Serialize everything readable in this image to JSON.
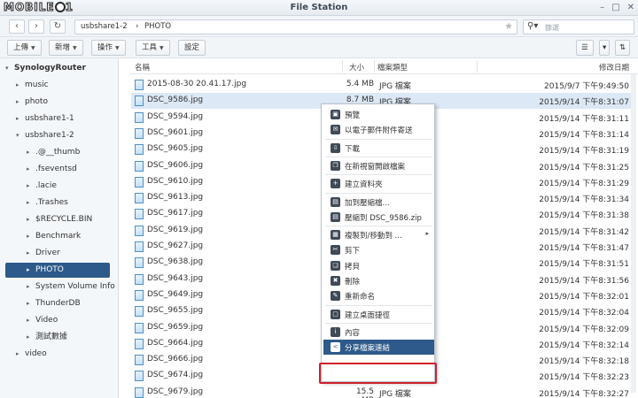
{
  "watermark": "MOBILE01",
  "window": {
    "title": "File Station"
  },
  "nav": {
    "path": [
      "usbshare1-2",
      "PHOTO"
    ],
    "search_placeholder": "篩選"
  },
  "toolbar": {
    "upload": "上傳",
    "create": "新增",
    "action": "操作",
    "tools": "工具",
    "settings": "設定"
  },
  "sidebar": {
    "root": "SynologyRouter",
    "items": [
      {
        "label": "music",
        "level": 1,
        "arrow": "▸"
      },
      {
        "label": "photo",
        "level": 1,
        "arrow": "▸"
      },
      {
        "label": "usbshare1-1",
        "level": 1,
        "arrow": "▸"
      },
      {
        "label": "usbshare1-2",
        "level": 1,
        "arrow": "▾"
      },
      {
        "label": ".@__thumb",
        "level": 2,
        "arrow": "▸"
      },
      {
        "label": ".fseventsd",
        "level": 2,
        "arrow": "▸"
      },
      {
        "label": ".lacie",
        "level": 2,
        "arrow": "▸"
      },
      {
        "label": ".Trashes",
        "level": 2,
        "arrow": "▸"
      },
      {
        "label": "$RECYCLE.BIN",
        "level": 2,
        "arrow": "▸"
      },
      {
        "label": "Benchmark",
        "level": 2,
        "arrow": "▸"
      },
      {
        "label": "Driver",
        "level": 2,
        "arrow": "▸"
      },
      {
        "label": "PHOTO",
        "level": 2,
        "arrow": "▸",
        "selected": true
      },
      {
        "label": "System Volume Info",
        "level": 2,
        "arrow": "▸"
      },
      {
        "label": "ThunderDB",
        "level": 2,
        "arrow": "▸"
      },
      {
        "label": "Video",
        "level": 2,
        "arrow": "▸"
      },
      {
        "label": "測試數據",
        "level": 2,
        "arrow": "▸"
      },
      {
        "label": "video",
        "level": 1,
        "arrow": "▸"
      }
    ]
  },
  "columns": {
    "name": "名稱",
    "size": "大小",
    "type": "檔案類型",
    "modified": "修改日期"
  },
  "files": [
    {
      "name": "2015-08-30 20.41.17.jpg",
      "size": "5.4 MB",
      "type": "JPG 檔案",
      "modified": "2015/9/7 下午9:49:50"
    },
    {
      "name": "DSC_9586.jpg",
      "size": "8.7 MB",
      "type": "JPG 檔案",
      "modified": "2015/9/14 下午8:31:07",
      "selected": true
    },
    {
      "name": "DSC_9594.jpg",
      "size": "",
      "type": "",
      "modified": "2015/9/14 下午8:31:11"
    },
    {
      "name": "DSC_9601.jpg",
      "size": "",
      "type": "",
      "modified": "2015/9/14 下午8:31:14"
    },
    {
      "name": "DSC_9605.jpg",
      "size": "",
      "type": "",
      "modified": "2015/9/14 下午8:31:19"
    },
    {
      "name": "DSC_9606.jpg",
      "size": "",
      "type": "",
      "modified": "2015/9/14 下午8:31:25"
    },
    {
      "name": "DSC_9610.jpg",
      "size": "",
      "type": "",
      "modified": "2015/9/14 下午8:31:29"
    },
    {
      "name": "DSC_9613.jpg",
      "size": "",
      "type": "",
      "modified": "2015/9/14 下午8:31:34"
    },
    {
      "name": "DSC_9617.jpg",
      "size": "",
      "type": "",
      "modified": "2015/9/14 下午8:31:38"
    },
    {
      "name": "DSC_9619.jpg",
      "size": "",
      "type": "",
      "modified": "2015/9/14 下午8:31:42"
    },
    {
      "name": "DSC_9627.jpg",
      "size": "",
      "type": "",
      "modified": "2015/9/14 下午8:31:47"
    },
    {
      "name": "DSC_9638.jpg",
      "size": "",
      "type": "",
      "modified": "2015/9/14 下午8:31:51"
    },
    {
      "name": "DSC_9643.jpg",
      "size": "",
      "type": "",
      "modified": "2015/9/14 下午8:31:56"
    },
    {
      "name": "DSC_9649.jpg",
      "size": "",
      "type": "",
      "modified": "2015/9/14 下午8:32:01"
    },
    {
      "name": "DSC_9655.jpg",
      "size": "",
      "type": "",
      "modified": "2015/9/14 下午8:32:04"
    },
    {
      "name": "DSC_9659.jpg",
      "size": "",
      "type": "",
      "modified": "2015/9/14 下午8:32:09"
    },
    {
      "name": "DSC_9664.jpg",
      "size": "",
      "type": "",
      "modified": "2015/9/14 下午8:32:14"
    },
    {
      "name": "DSC_9666.jpg",
      "size": "",
      "type": "",
      "modified": "2015/9/14 下午8:32:18"
    },
    {
      "name": "DSC_9674.jpg",
      "size": "",
      "type": "",
      "modified": "2015/9/14 下午8:32:23"
    },
    {
      "name": "DSC_9679.jpg",
      "size": "15.5 MB",
      "type": "JPG 檔案",
      "modified": "2015/9/14 下午8:32:27"
    }
  ],
  "context_menu": [
    {
      "label": "預覽",
      "icon": "preview-icon",
      "glyph": "▣"
    },
    {
      "label": "以電子郵件附件寄送",
      "icon": "mail-icon",
      "glyph": "✉"
    },
    {
      "sep": true
    },
    {
      "label": "下載",
      "icon": "download-icon",
      "glyph": "⇩"
    },
    {
      "sep": true
    },
    {
      "label": "在新視窗開啟檔案",
      "icon": "new-window-icon",
      "glyph": "❐"
    },
    {
      "sep": true
    },
    {
      "label": "建立資料夾",
      "icon": "new-folder-icon",
      "glyph": "+"
    },
    {
      "sep": true
    },
    {
      "label": "加到壓縮檔...",
      "icon": "archive-icon",
      "glyph": "▤"
    },
    {
      "label": "壓縮到 DSC_9586.zip",
      "icon": "zip-icon",
      "glyph": "▤"
    },
    {
      "sep": true
    },
    {
      "label": "複製到/移動到 ...",
      "icon": "copy-move-icon",
      "glyph": "▦",
      "submenu": "▸"
    },
    {
      "label": "剪下",
      "icon": "cut-icon",
      "glyph": "✂"
    },
    {
      "label": "拷貝",
      "icon": "copy-icon",
      "glyph": "❏"
    },
    {
      "label": "刪除",
      "icon": "delete-icon",
      "glyph": "✖"
    },
    {
      "label": "重新命名",
      "icon": "rename-icon",
      "glyph": "✎"
    },
    {
      "sep": true
    },
    {
      "label": "建立桌面捷徑",
      "icon": "shortcut-icon",
      "glyph": "▢"
    },
    {
      "sep": true
    },
    {
      "label": "內容",
      "icon": "info-icon",
      "glyph": "i"
    },
    {
      "label": "分享檔案連結",
      "icon": "share-icon",
      "glyph": "<",
      "highlighted": true
    }
  ],
  "colors": {
    "selection": "#2d5a8a",
    "row_selected": "#dce8f5",
    "annotation": "#d0202a"
  }
}
